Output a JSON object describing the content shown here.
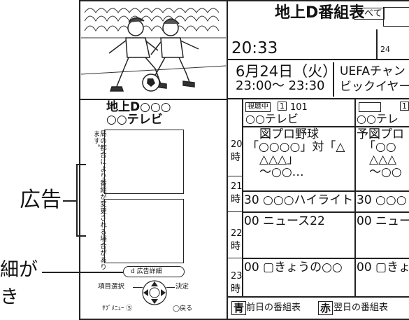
{
  "header": {
    "title": "地上D番組表",
    "tab_all": "すべて",
    "time": "20:33",
    "small_num": "24"
  },
  "program": {
    "date": "6月24日（火）",
    "time_range": "23:00〜 23:30",
    "title_line1": "UEFAチャン",
    "title_line2": "ビックイヤー"
  },
  "left_panel": {
    "broadcast_type": "地上D○○○",
    "station_name": "○○テレビ",
    "notice": "局の都合により番組が変更される場合があります。",
    "ad_detail_button": "d 広告詳細",
    "item_select": "項目選択",
    "decide": "決定",
    "submenu": "ｻﾌﾞﾒﾆｭｰ Ⓢ",
    "back": "◯戻る"
  },
  "annotations": {
    "ad_label": "広告",
    "detail_label_line1": "細が",
    "detail_label_line2": "き"
  },
  "channels": [
    {
      "status_tag": "視聴中",
      "number": "101",
      "name": "○○テレビ"
    },
    {
      "status_tag": "",
      "number": "",
      "name": "○○テレ"
    }
  ],
  "hours": [
    "20時",
    "21時",
    "22時",
    "23時"
  ],
  "hour_digits": [
    "20",
    "21",
    "22",
    "23"
  ],
  "hour_char": "時",
  "ch1_programs": {
    "baseball_line1": "図プロ野球",
    "baseball_line2": "「○○○○」対「△",
    "baseball_line3": "△△△」",
    "baseball_line4": "〜○○…",
    "highlight": "30 ○○○ハイライト",
    "news": "00 ニュース22",
    "kyou": "00 ▢きょうの○○"
  },
  "ch2_programs": {
    "baseball_line1": "予図プロ",
    "baseball_line2": "「○○",
    "baseball_line3": "△△△",
    "baseball_line4": "〜○○",
    "highlight": "30 ○○○",
    "news": "00 ニュー",
    "kyou": "00 ▢きょ"
  },
  "footer": {
    "blue_key": "青",
    "prev_day": "前日の番組表",
    "red_key": "赤",
    "next_day": "翌日の番組表"
  }
}
